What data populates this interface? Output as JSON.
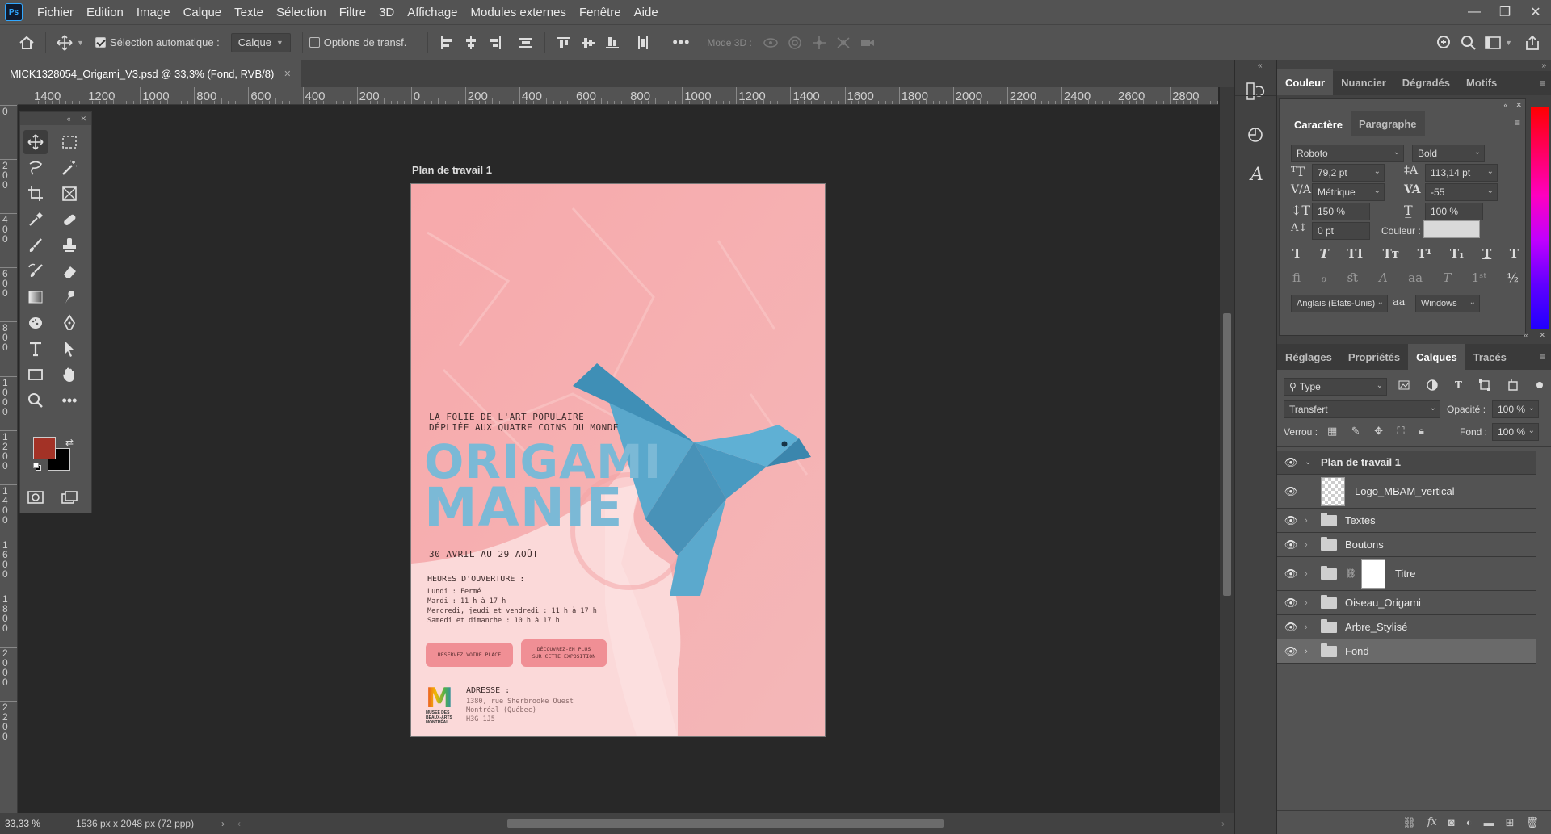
{
  "app": {
    "logo_text": "Ps"
  },
  "menu": [
    "Fichier",
    "Edition",
    "Image",
    "Calque",
    "Texte",
    "Sélection",
    "Filtre",
    "3D",
    "Affichage",
    "Modules externes",
    "Fenêtre",
    "Aide"
  ],
  "options_bar": {
    "auto_select_label": "Sélection automatique :",
    "auto_select_value": "Calque",
    "transform_label": "Options de transf.",
    "mode3d_label": "Mode 3D :"
  },
  "document": {
    "tab_title": "MICK1328054_Origami_V3.psd @ 33,3% (Fond, RVB/8)",
    "artboard_label": "Plan de travail 1"
  },
  "ruler_ticks": [
    "1400",
    "1200",
    "1000",
    "800",
    "600",
    "400",
    "200",
    "0",
    "200",
    "400",
    "600",
    "800",
    "1000",
    "1200",
    "1400",
    "1600",
    "1800",
    "2000",
    "2200",
    "2400",
    "2600",
    "2800"
  ],
  "ruler_v_ticks": [
    "0",
    "2 0 0",
    "4 0 0",
    "6 0 0",
    "8 0 0",
    "1 0 0 0",
    "1 2 0 0",
    "1 4 0 0",
    "1 6 0 0",
    "1 8 0 0",
    "2 0 0 0",
    "2 2 0 0"
  ],
  "poster": {
    "tagline1": "LA FOLIE DE L'ART POPULAIRE",
    "tagline2": "DÉPLIÉE AUX QUATRE COINS DU MONDE",
    "title1": "ORIGAMI",
    "title2": "MANIE",
    "dates": "30 AVRIL AU 29 AOÛT",
    "hours_title": "HEURES D'OUVERTURE :",
    "hours": [
      "Lundi : Fermé",
      "Mardi : 11 h à 17 h",
      "Mercredi, jeudi et vendredi : 11 h à 17 h",
      "Samedi et dimanche : 10 h à 17 h"
    ],
    "btn1": "RÉSERVEZ VOTRE PLACE",
    "btn2_line1": "DÉCOUVREZ-EN PLUS",
    "btn2_line2": "SUR CETTE EXPOSITION",
    "logo_letter": "M",
    "logo_text": [
      "MUSÉE DES",
      "BEAUX-ARTS",
      "MONTRÉAL"
    ],
    "address_title": "ADRESSE :",
    "address": [
      "1380, rue Sherbrooke Ouest",
      "Montréal (Québec)",
      "H3G 1J5"
    ]
  },
  "status": {
    "zoom": "33,33 %",
    "doc_size": "1536 px x 2048 px (72 ppp)"
  },
  "color_panel": {
    "tabs": [
      "Couleur",
      "Nuancier",
      "Dégradés",
      "Motifs"
    ]
  },
  "character_panel": {
    "tabs": [
      "Caractère",
      "Paragraphe"
    ],
    "font_family": "Roboto",
    "font_style": "Bold",
    "font_size": "79,2 pt",
    "leading": "113,14 pt",
    "kerning": "Métrique",
    "tracking": "-55",
    "vscale": "150 %",
    "hscale": "100 %",
    "baseline": "0 pt",
    "color_label": "Couleur :",
    "color_value": "#d9d9d9",
    "language": "Anglais (Etats-Unis)",
    "antialias_icon": "aa",
    "antialias": "Windows"
  },
  "layers_panel": {
    "tabs": [
      "Réglages",
      "Propriétés",
      "Calques",
      "Tracés"
    ],
    "filter": "Type",
    "blend_mode": "Transfert",
    "opacity_label": "Opacité :",
    "opacity": "100 %",
    "lock_label": "Verrou :",
    "fill_label": "Fond :",
    "fill": "100 %",
    "layers": [
      "Plan de travail 1",
      "Logo_MBAM_vertical",
      "Textes",
      "Boutons",
      "Titre",
      "Oiseau_Origami",
      "Arbre_Stylisé",
      "Fond"
    ]
  },
  "colors": {
    "foreground": "#a33226",
    "background": "#000000",
    "poster_bg": "#f6b3b4",
    "bird": "#4e9dc0"
  }
}
